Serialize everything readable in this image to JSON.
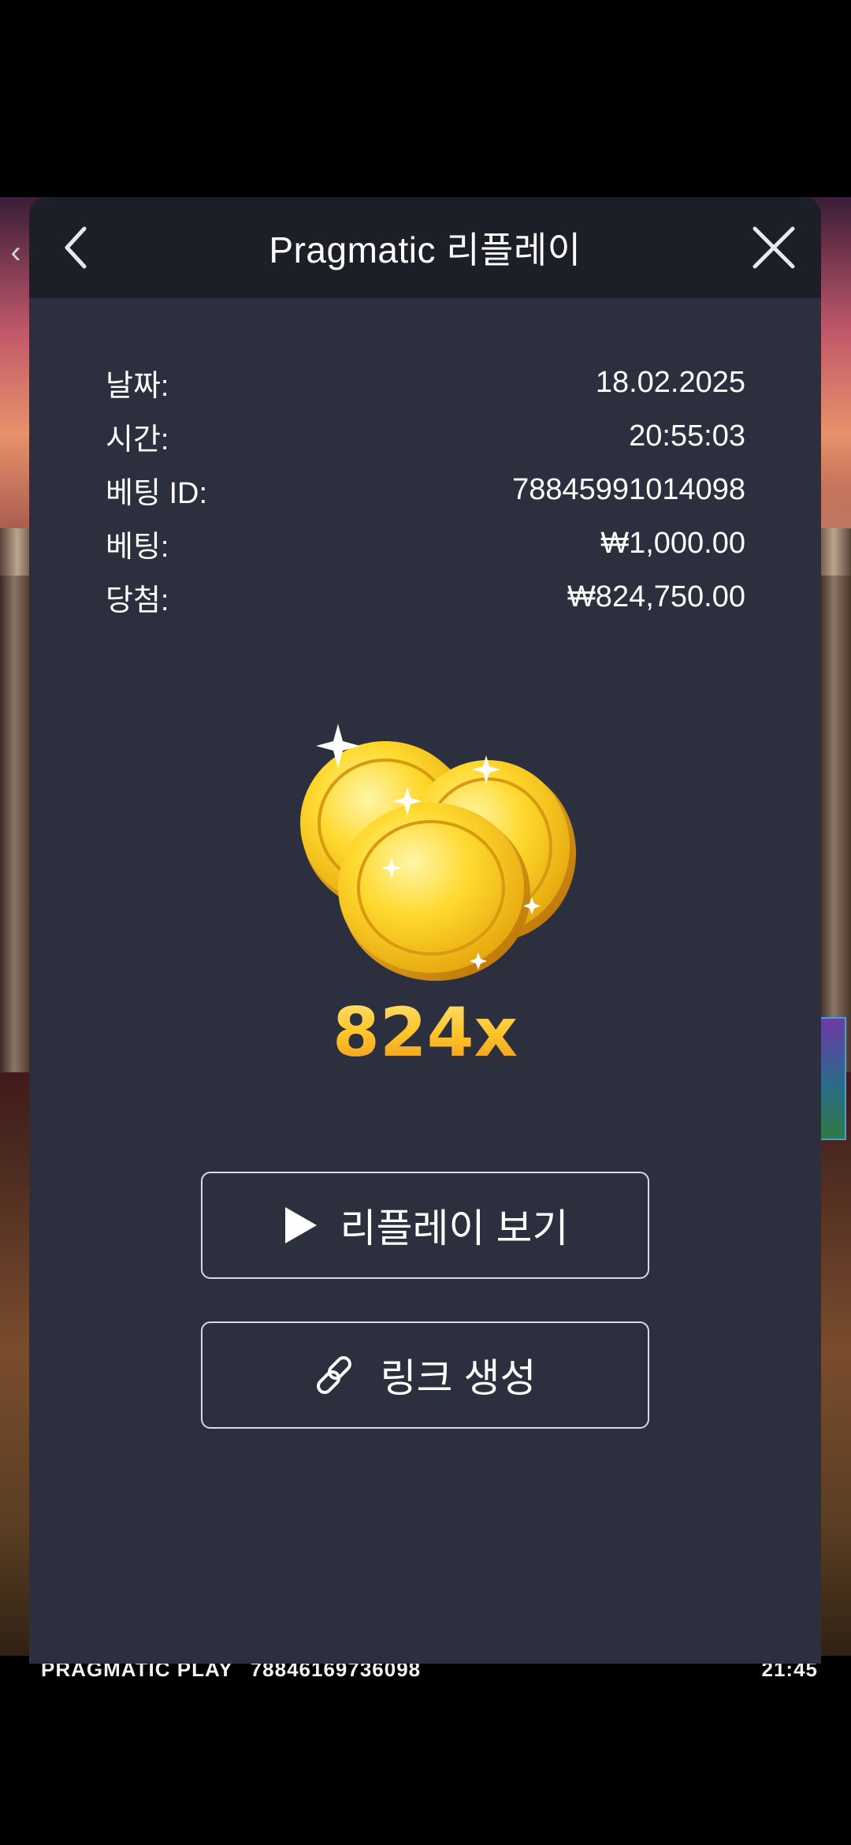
{
  "panel": {
    "title": "Pragmatic 리플레이"
  },
  "details": [
    {
      "label": "날짜:",
      "value": "18.02.2025"
    },
    {
      "label": "시간:",
      "value": "20:55:03"
    },
    {
      "label": "베팅 ID:",
      "value": "78845991014098"
    },
    {
      "label": "베팅:",
      "value": "₩1,000.00"
    },
    {
      "label": "당첨:",
      "value": "₩824,750.00"
    }
  ],
  "win": {
    "multiplier": "824x"
  },
  "buttons": {
    "watch_replay": "리플레이 보기",
    "create_link": "링크 생성"
  },
  "game_bar": {
    "brand": "PRAGMATIC PLAY",
    "round_id": "78846169736098",
    "clock": "21:45"
  },
  "side_tab": {
    "glyph": "‹"
  },
  "icons": {
    "back": "chevron-left-icon",
    "close": "close-icon",
    "play": "play-icon",
    "link": "link-icon",
    "coins": "gold-coins-icon"
  },
  "colors": {
    "panel_bg": "#2c2f3e",
    "header_bg": "#1c1e28",
    "multiplier_gold": "#f6b720",
    "text": "#ffffff"
  }
}
